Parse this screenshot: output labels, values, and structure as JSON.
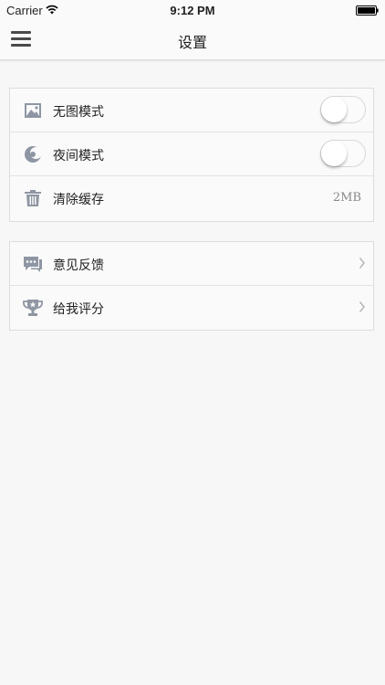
{
  "status_bar": {
    "carrier": "Carrier",
    "time": "9:12 PM"
  },
  "nav": {
    "title": "设置"
  },
  "settings_group_1": {
    "rows": [
      {
        "label": "无图模式",
        "icon": "image-icon",
        "toggle_on": false
      },
      {
        "label": "夜间模式",
        "icon": "moon-icon",
        "toggle_on": false
      },
      {
        "label": "清除缓存",
        "icon": "trash-icon",
        "value": "2MB"
      }
    ]
  },
  "settings_group_2": {
    "rows": [
      {
        "label": "意见反馈",
        "icon": "feedback-icon"
      },
      {
        "label": "给我评分",
        "icon": "trophy-icon"
      }
    ]
  },
  "colors": {
    "icon_gray": "#8f96a3",
    "background": "#f7f7f7",
    "row_background": "#fafafa"
  }
}
